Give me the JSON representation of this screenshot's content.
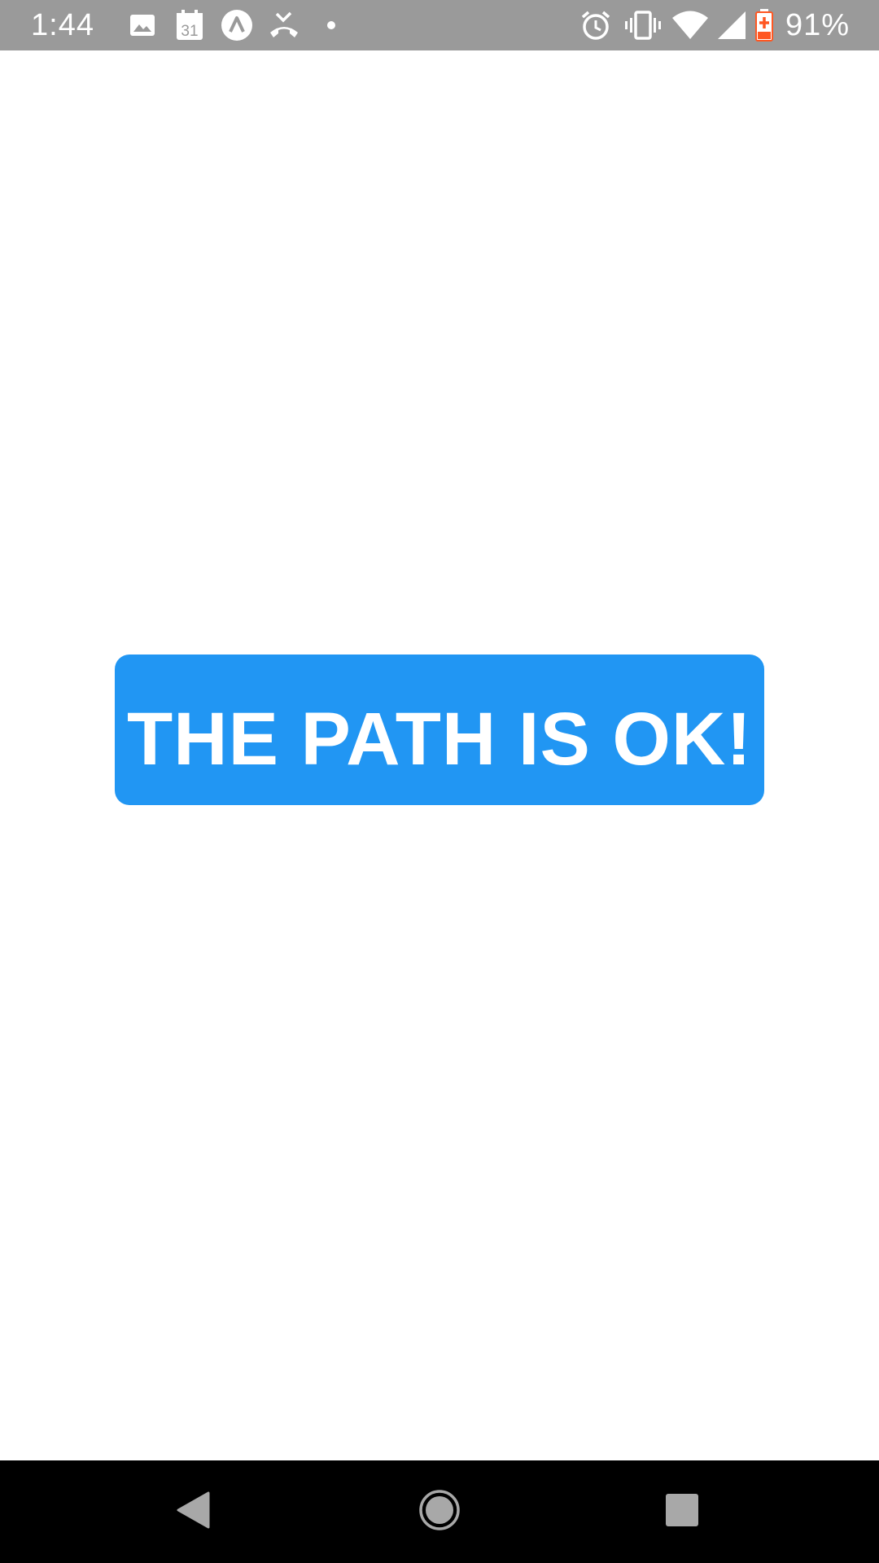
{
  "status_bar": {
    "time": "1:44",
    "battery_percent": "91%",
    "icons": [
      "image-icon",
      "calendar-icon",
      "app-circle-icon",
      "missed-call-icon",
      "dot-icon",
      "alarm-icon",
      "vibrate-icon",
      "wifi-icon",
      "signal-icon",
      "battery-charging-icon"
    ],
    "calendar_day": "31",
    "background_color": "#9a9a9a"
  },
  "main": {
    "button_label": "THE PATH IS OK!",
    "button_color": "#2196f3"
  },
  "nav_bar": {
    "buttons": [
      "back-icon",
      "home-icon",
      "recents-icon"
    ]
  }
}
